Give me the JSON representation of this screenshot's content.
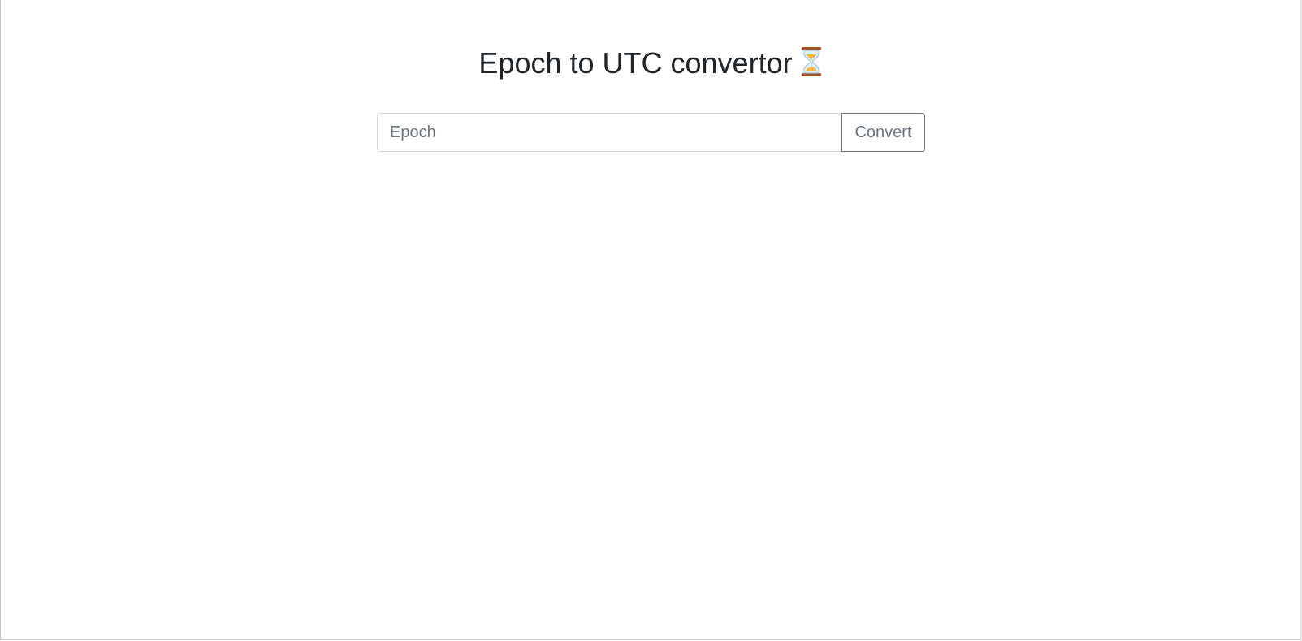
{
  "page": {
    "title": "Epoch to UTC convertor",
    "title_icon": "hourglass-icon"
  },
  "form": {
    "epoch_value": "",
    "epoch_placeholder": "Epoch",
    "convert_label": "Convert"
  },
  "colors": {
    "text": "#212529",
    "placeholder": "#6c757d",
    "input_border": "#ced4da",
    "button_border": "#6c757d",
    "background": "#ffffff"
  }
}
